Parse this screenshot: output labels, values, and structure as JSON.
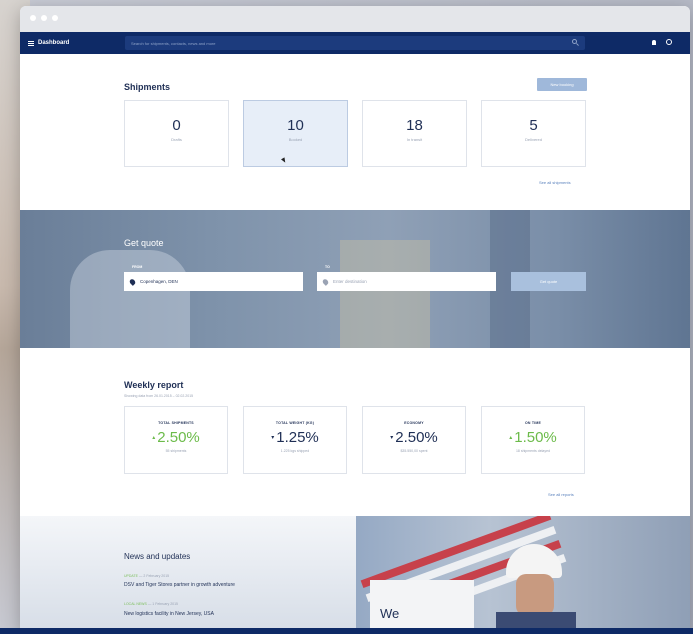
{
  "appbar": {
    "dashboard_label": "Dashboard",
    "search_placeholder": "Search for shipments, contacts, news and more"
  },
  "shipments": {
    "title": "Shipments",
    "new_booking_label": "New booking",
    "stats": [
      {
        "value": "0",
        "label": "Drafts"
      },
      {
        "value": "10",
        "label": "Booked"
      },
      {
        "value": "18",
        "label": "In transit"
      },
      {
        "value": "5",
        "label": "Delivered"
      }
    ],
    "see_all_label": "See all shipments"
  },
  "quote": {
    "title": "Get quote",
    "from_label": "FROM",
    "from_value": "Copenhagen, DEN",
    "to_label": "TO",
    "to_placeholder": "Enter destination",
    "button_label": "Get quote"
  },
  "weekly": {
    "title": "Weekly report",
    "subtitle": "Showing data from 26.01.2015 – 02.02.2015",
    "cards": [
      {
        "label": "TOTAL SHIPMENTS",
        "arrow": "▴",
        "value": "2.50%",
        "sub": "55 shipments",
        "color": "#6cbb4a"
      },
      {
        "label": "TOTAL WEIGHT (KG)",
        "arrow": "▾",
        "value": "1.25%",
        "sub": "1.225 kgs shipped",
        "color": "#1f2f55"
      },
      {
        "label": "ECONOMY",
        "arrow": "▾",
        "value": "2.50%",
        "sub": "$35.550,00 spent",
        "color": "#1f2f55"
      },
      {
        "label": "ON TIME",
        "arrow": "▴",
        "value": "1.50%",
        "sub": "18 shipments delayed",
        "color": "#6cbb4a"
      }
    ],
    "see_all_label": "See all reports"
  },
  "news": {
    "title": "News and updates",
    "items": [
      {
        "category": "UPDATE",
        "date": "2 February 2015",
        "headline": "DSV and Tiger Stores partner in growth adventure"
      },
      {
        "category": "LOCAL NEWS",
        "date": "1 February 2015",
        "headline": "New logistics facility in New Jersey, USA"
      }
    ],
    "image_caption": "We"
  },
  "colors": {
    "navy": "#0e2a66",
    "accent_green": "#6cbb4a",
    "button_blue": "#9fb8da"
  }
}
